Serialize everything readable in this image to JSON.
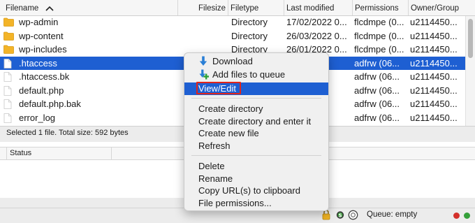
{
  "columns": {
    "filename": "Filename",
    "filesize": "Filesize",
    "filetype": "Filetype",
    "last_modified": "Last modified",
    "permissions": "Permissions",
    "owner_group": "Owner/Group"
  },
  "files": [
    {
      "name": "wp-admin",
      "type": "Directory",
      "modified": "17/02/2022 0...",
      "permissions": "flcdmpe (0...",
      "owner": "u2114450..."
    },
    {
      "name": "wp-content",
      "type": "Directory",
      "modified": "26/03/2022 0...",
      "permissions": "flcdmpe (0...",
      "owner": "u2114450..."
    },
    {
      "name": "wp-includes",
      "type": "Directory",
      "modified": "26/01/2022 0...",
      "permissions": "flcdmpe (0...",
      "owner": "u2114450..."
    },
    {
      "name": ".htaccess",
      "type": "",
      "modified": "2 0...",
      "permissions": "adfrw (06...",
      "owner": "u2114450..."
    },
    {
      "name": ".htaccess.bk",
      "type": "",
      "modified": "2 0...",
      "permissions": "adfrw (06...",
      "owner": "u2114450..."
    },
    {
      "name": "default.php",
      "type": "",
      "modified": "1 0...",
      "permissions": "adfrw (06...",
      "owner": "u2114450..."
    },
    {
      "name": "default.php.bak",
      "type": "",
      "modified": "1 0...",
      "permissions": "adfrw (06...",
      "owner": "u2114450..."
    },
    {
      "name": "error_log",
      "type": "",
      "modified": "2 0...",
      "permissions": "adfrw (06...",
      "owner": "u2114450..."
    }
  ],
  "status_text": "Selected 1 file. Total size: 592 bytes",
  "queue": {
    "status_col": "Status"
  },
  "bottom": {
    "queue_label": "Queue: empty"
  },
  "context_menu": {
    "group1": [
      "Download",
      "Add files to queue",
      "View/Edit"
    ],
    "group2": [
      "Create directory",
      "Create directory and enter it",
      "Create new file",
      "Refresh"
    ],
    "group3": [
      "Delete",
      "Rename",
      "Copy URL(s) to clipboard",
      "File permissions..."
    ]
  },
  "colors": {
    "selection": "#1e5fd2",
    "highlight_box": "#e0251b",
    "folder": "#f3b428",
    "download_arrow": "#2a7fd6",
    "add_plus": "#2fa33a"
  },
  "icons": {
    "sort": "chevron-up-icon",
    "folder": "folder-icon",
    "file": "file-icon",
    "download": "download-arrow-icon",
    "add_to_queue": "add-to-queue-icon",
    "lock": "lock-icon",
    "settings": "gear-icon",
    "speed": "speed-limit-icon",
    "receive_led": "red-led-icon",
    "send_led": "green-led-icon"
  }
}
